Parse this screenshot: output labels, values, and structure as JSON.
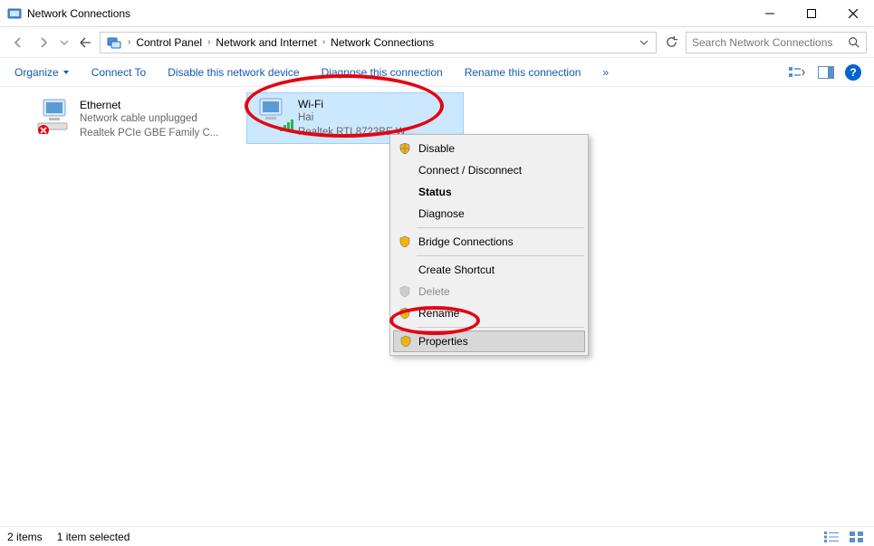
{
  "window": {
    "title": "Network Connections"
  },
  "breadcrumb": {
    "items": [
      {
        "label": "Control Panel"
      },
      {
        "label": "Network and Internet"
      },
      {
        "label": "Network Connections"
      }
    ]
  },
  "search": {
    "placeholder": "Search Network Connections"
  },
  "toolbar": {
    "organize": "Organize",
    "connect_to": "Connect To",
    "disable": "Disable this network device",
    "diagnose": "Diagnose this connection",
    "rename": "Rename this connection",
    "more": "»"
  },
  "connections": [
    {
      "name": "Ethernet",
      "status": "Network cable unplugged",
      "device": "Realtek PCIe GBE Family C..."
    },
    {
      "name": "Wi-Fi",
      "status": "Hai",
      "device": "Realtek RTL8723BE W..."
    }
  ],
  "context_menu": {
    "disable": "Disable",
    "connect": "Connect / Disconnect",
    "status": "Status",
    "diagnose": "Diagnose",
    "bridge": "Bridge Connections",
    "shortcut": "Create Shortcut",
    "delete": "Delete",
    "rename": "Rename",
    "properties": "Properties"
  },
  "statusbar": {
    "items": "2 items",
    "selected": "1 item selected"
  }
}
